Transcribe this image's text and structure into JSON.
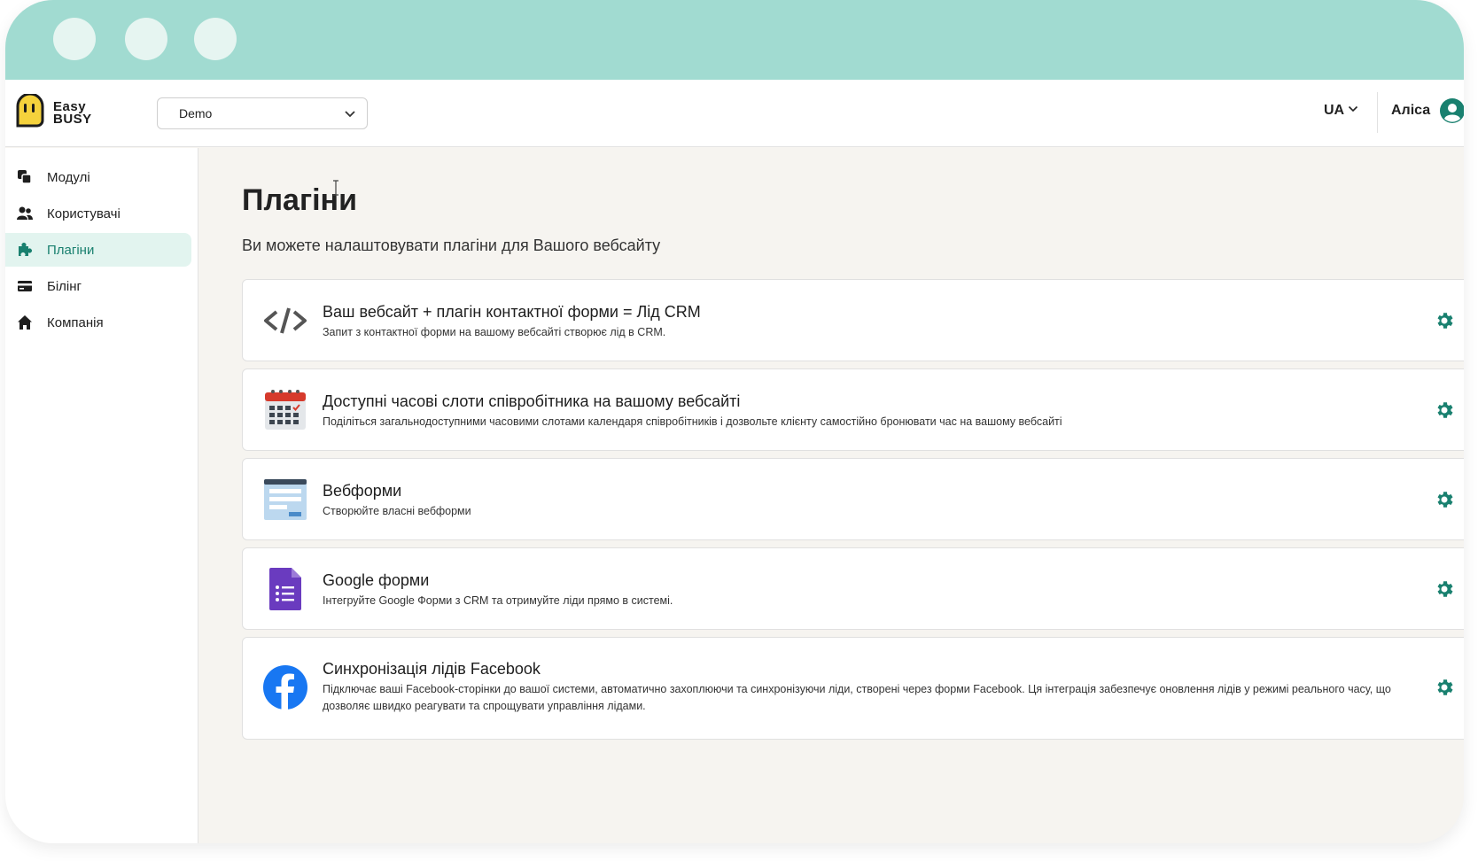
{
  "header": {
    "logo_text": "Easy BUSY",
    "org_select": {
      "value": "Demo"
    },
    "language": "UA",
    "user_name": "Аліса"
  },
  "sidebar": {
    "items": [
      {
        "label": "Модулі",
        "icon": "modules-icon",
        "active": false
      },
      {
        "label": "Користувачі",
        "icon": "users-icon",
        "active": false
      },
      {
        "label": "Плагіни",
        "icon": "puzzle-icon",
        "active": true
      },
      {
        "label": "Білінг",
        "icon": "credit-card-icon",
        "active": false
      },
      {
        "label": "Компанія",
        "icon": "home-icon",
        "active": false
      }
    ]
  },
  "main": {
    "title": "Плагіни",
    "subtitle": "Ви можете налаштовувати плагіни для Вашого вебсайту",
    "plugins": [
      {
        "icon": "code-icon",
        "title": "Ваш вебсайт + плагін контактної форми = Лід CRM",
        "description": "Запит з контактної форми на вашому вебсайті створює лід в CRM."
      },
      {
        "icon": "calendar-icon",
        "title": "Доступні часові слоти співробітника на вашому вебсайті",
        "description": "Поділіться загальнодоступними часовими слотами календаря співробітників і дозвольте клієнту самостійно бронювати час на вашому вебсайті"
      },
      {
        "icon": "webform-icon",
        "title": "Вебформи",
        "description": "Створюйте власні вебформи"
      },
      {
        "icon": "google-forms-icon",
        "title": "Google форми",
        "description": "Інтегруйте Google Форми з CRM та отримуйте ліди прямо в системі."
      },
      {
        "icon": "facebook-icon",
        "title": "Синхронізація лідів Facebook",
        "description": "Підключає ваші Facebook-сторінки до вашої системи, автоматично захоплюючи та синхронізуючи ліди, створені через форми Facebook. Ця інтеграція забезпечує оновлення лідів у режимі реального часу, що дозволяє швидко реагувати та спрощувати управління лідами."
      }
    ]
  },
  "colors": {
    "titlebar": "#a1dbd1",
    "accent": "#19806f",
    "active_bg": "#e2f4ef",
    "page_bg": "#f6f4f0"
  }
}
